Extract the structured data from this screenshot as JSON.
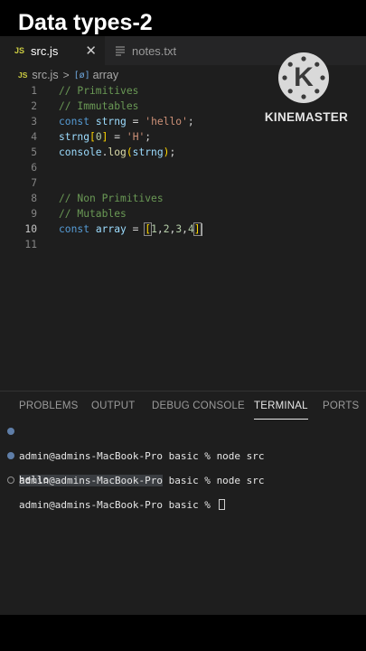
{
  "video_title": "Data types-2",
  "tabs": [
    {
      "icon": "JS",
      "label": "src.js",
      "active": true
    },
    {
      "label": "notes.txt",
      "active": false
    }
  ],
  "breadcrumb": {
    "icon": "JS",
    "file": "src.js",
    "separator": ">",
    "symbol_icon": "[ø]",
    "symbol": "array"
  },
  "code_lines": [
    {
      "n": "1",
      "text": "// Primitives"
    },
    {
      "n": "2",
      "text": "// Immutables"
    },
    {
      "n": "3",
      "text": "const strng = 'hello';"
    },
    {
      "n": "4",
      "text": "strng[0] = 'H';"
    },
    {
      "n": "5",
      "text": "console.log(strng);"
    },
    {
      "n": "6",
      "text": ""
    },
    {
      "n": "7",
      "text": ""
    },
    {
      "n": "8",
      "text": "// Non Primitives"
    },
    {
      "n": "9",
      "text": "// Mutables"
    },
    {
      "n": "10",
      "text": "const array = [1,2,3,4]"
    },
    {
      "n": "11",
      "text": ""
    }
  ],
  "tokens": {
    "c1": "// Primitives",
    "c2": "// Immutables",
    "l3": {
      "kw": "const",
      "var": "strng",
      "eq": "=",
      "str": "'hello'",
      "semi": ";"
    },
    "l4": {
      "var": "strng",
      "ob": "[",
      "num": "0",
      "cb": "]",
      "eq": "=",
      "str": "'H'",
      "semi": ";"
    },
    "l5": {
      "obj": "console",
      "dot": ".",
      "fn": "log",
      "op": "(",
      "arg": "strng",
      "cp": ")",
      "semi": ";"
    },
    "c8": "// Non Primitives",
    "c9": "// Mutables",
    "l10": {
      "kw": "const",
      "var": "array",
      "eq": "=",
      "ob": "[",
      "n1": "1",
      "n2": "2",
      "n3": "3",
      "n4": "4",
      "comma": ",",
      "cb": "]"
    }
  },
  "watermark": {
    "letter": "K",
    "text": "KINEMASTER"
  },
  "panel_tabs": [
    "PROBLEMS",
    "OUTPUT",
    "DEBUG CONSOLE",
    "TERMINAL",
    "PORTS"
  ],
  "active_panel_tab": "TERMINAL",
  "terminal": {
    "prompt_user": "admin@admins-MacBook-Pro",
    "prompt_dir_suffix": " basic % ",
    "command": "node src",
    "output": "hello"
  }
}
